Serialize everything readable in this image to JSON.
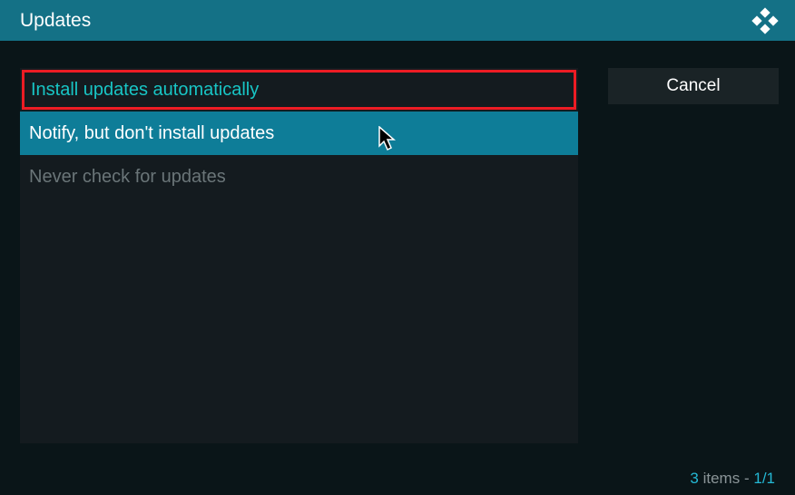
{
  "header": {
    "title": "Updates"
  },
  "options": {
    "items": [
      {
        "label": "Install updates automatically",
        "state": "selected"
      },
      {
        "label": "Notify, but don't install updates",
        "state": "hovered"
      },
      {
        "label": "Never check for updates",
        "state": "normal"
      }
    ]
  },
  "buttons": {
    "cancel": "Cancel"
  },
  "footer": {
    "count": "3",
    "items_label": "items",
    "separator": "-",
    "page": "1/1"
  }
}
